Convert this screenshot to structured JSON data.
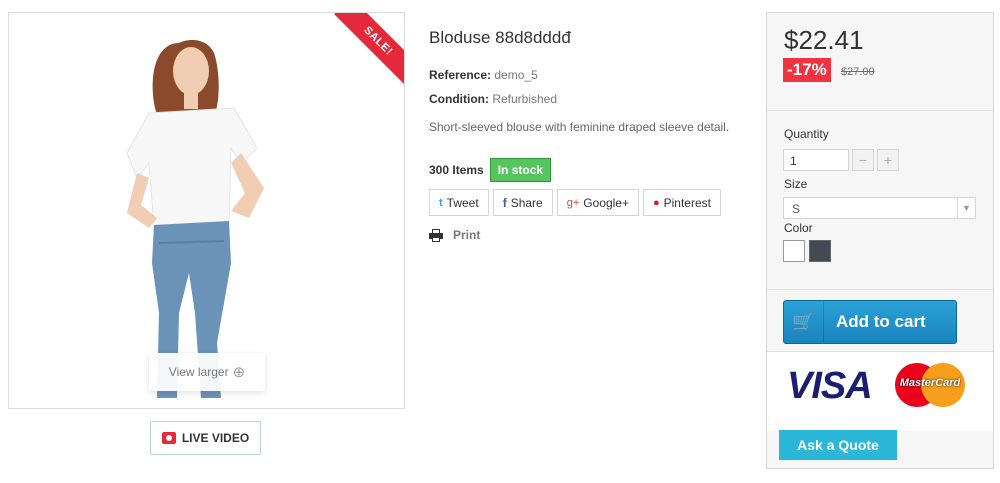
{
  "product": {
    "title": "Bloduse 88d8dddđ",
    "reference_label": "Reference:",
    "reference_value": "demo_5",
    "condition_label": "Condition:",
    "condition_value": "Refurbished",
    "description": "Short-sleeved blouse with feminine draped sleeve detail.",
    "items_count": "300 Items",
    "stock_status": "In stock"
  },
  "image": {
    "sale_badge": "SALE!",
    "view_larger": "View larger",
    "live_video": "LIVE VIDEO"
  },
  "social": {
    "tweet": "Tweet",
    "share": "Share",
    "googleplus": "Google+",
    "pinterest": "Pinterest"
  },
  "print_label": "Print",
  "buy": {
    "price": "$22.41",
    "discount": "-17%",
    "old_price": "$27.00",
    "quantity_label": "Quantity",
    "quantity_value": "1",
    "size_label": "Size",
    "size_value": "S",
    "color_label": "Color",
    "colors": [
      "#ffffff",
      "#434a54"
    ],
    "add_to_cart": "Add to cart",
    "ask_quote": "Ask a Quote",
    "visa_text": "VISA",
    "mastercard_text": "MasterCard"
  },
  "icons": {
    "twitter": "twitter-icon",
    "facebook": "facebook-icon",
    "googleplus": "google-plus-icon",
    "pinterest": "pinterest-icon",
    "print": "printer-icon",
    "cart": "cart-icon",
    "zoom": "zoom-in-icon",
    "camera": "camera-icon"
  }
}
